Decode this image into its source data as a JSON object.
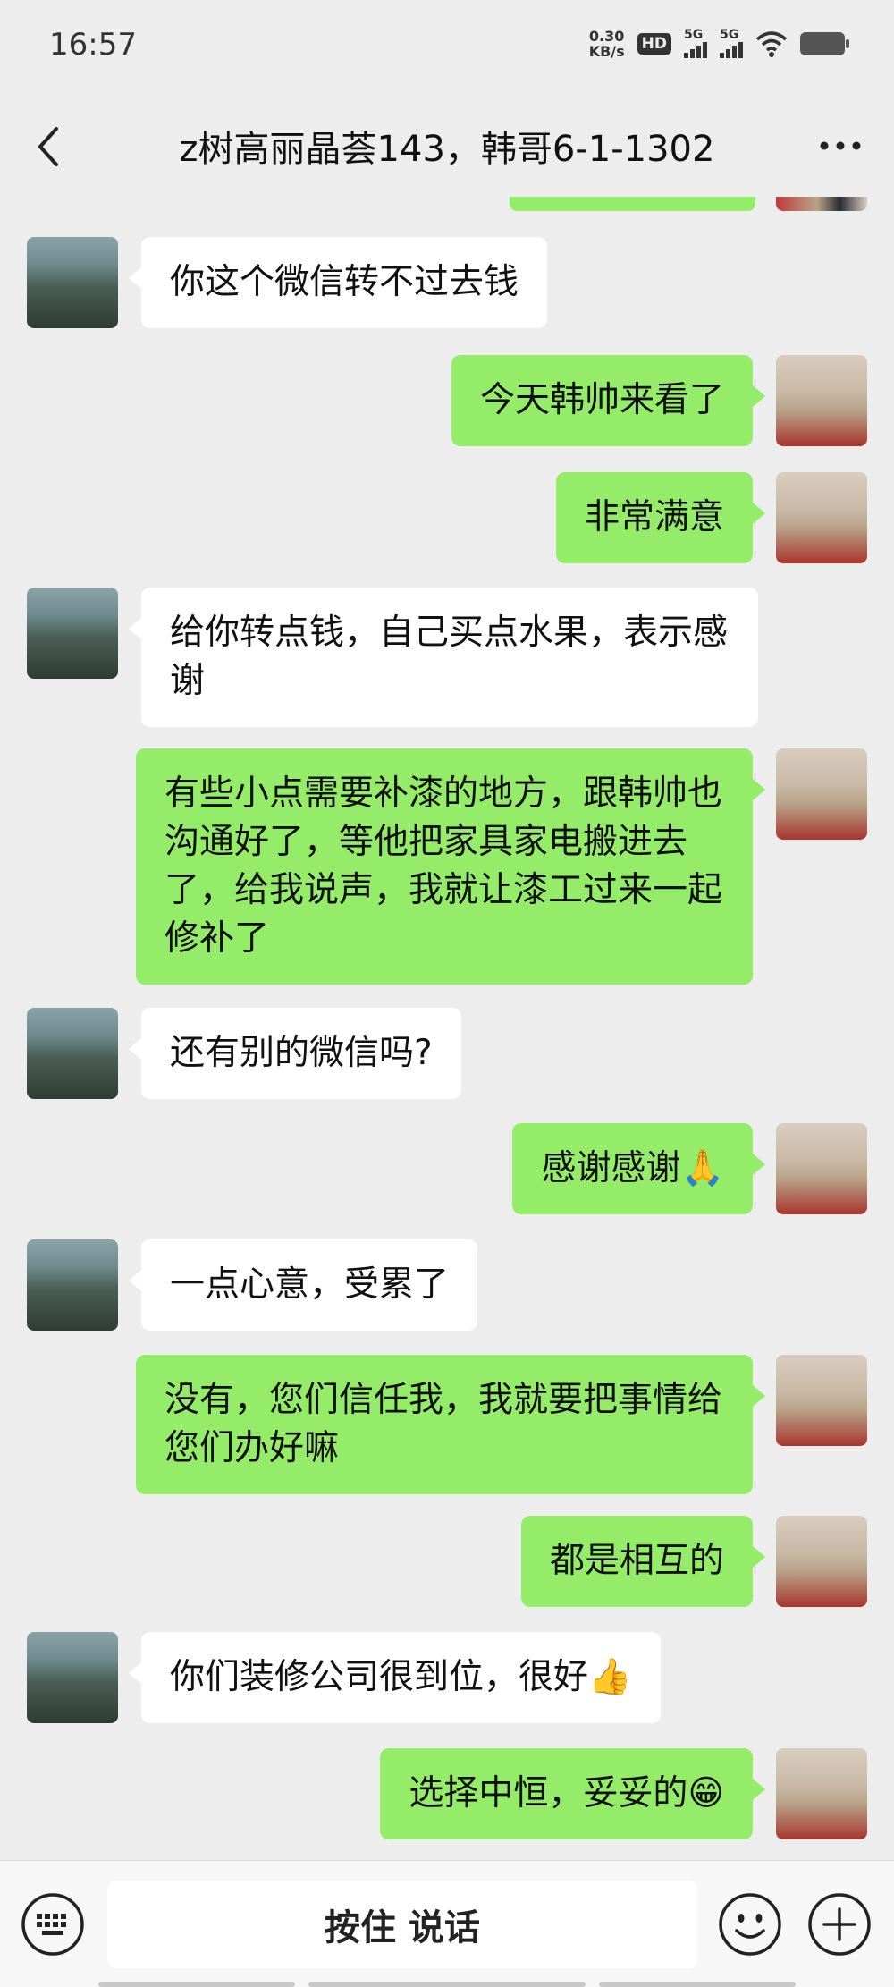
{
  "status_bar": {
    "time": "16:57",
    "net_speed_value": "0.30",
    "net_speed_unit": "KB/s",
    "hd_label": "HD",
    "signal1_label": "5G",
    "signal2_label": "5G"
  },
  "header": {
    "title": "z树高丽晶荟143，韩哥6-1-1302"
  },
  "messages": [
    {
      "side": "left",
      "text": "你这个微信转不过去钱"
    },
    {
      "side": "right",
      "text": "今天韩帅来看了"
    },
    {
      "side": "right",
      "text": "非常满意"
    },
    {
      "side": "left",
      "text": "给你转点钱，自己买点水果，表示感谢"
    },
    {
      "side": "right",
      "text": "有些小点需要补漆的地方，跟韩帅也沟通好了，等他把家具家电搬进去了，给我说声，我就让漆工过来一起修补了"
    },
    {
      "side": "left",
      "text": "还有别的微信吗?"
    },
    {
      "side": "right",
      "text": "感谢感谢",
      "emoji": "🙏"
    },
    {
      "side": "left",
      "text": "一点心意，受累了"
    },
    {
      "side": "right",
      "text": "没有，您们信任我，我就要把事情给您们办好嘛"
    },
    {
      "side": "right",
      "text": "都是相互的"
    },
    {
      "side": "left",
      "text": "你们装修公司很到位，很好",
      "emoji": "👍"
    },
    {
      "side": "right",
      "text": "选择中恒，妥妥的",
      "emoji": "😁"
    }
  ],
  "input_bar": {
    "hold_to_talk_label": "按住 说话"
  },
  "icons": {
    "back": "back-arrow-icon",
    "more": "more-icon",
    "keyboard": "voice-keyboard-icon",
    "emoji": "emoji-icon",
    "plus": "plus-icon"
  },
  "colors": {
    "background": "#EDEDED",
    "outgoing_bubble": "#95EC69",
    "incoming_bubble": "#FFFFFF",
    "input_bar": "#F7F7F7"
  }
}
